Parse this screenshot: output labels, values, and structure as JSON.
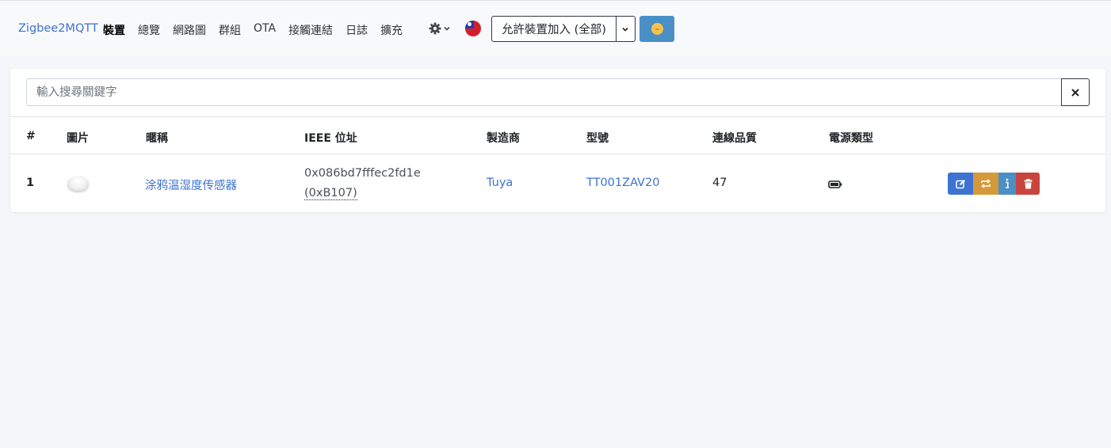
{
  "navbar": {
    "brand": "Zigbee2MQTT",
    "links": [
      {
        "label": "裝置",
        "active": true
      },
      {
        "label": "總覽",
        "active": false
      },
      {
        "label": "網路圖",
        "active": false
      },
      {
        "label": "群組",
        "active": false
      },
      {
        "label": "OTA",
        "active": false
      },
      {
        "label": "接觸連結",
        "active": false
      },
      {
        "label": "日誌",
        "active": false
      },
      {
        "label": "擴充",
        "active": false
      }
    ],
    "settings_icon": "gear-icon",
    "language_flag_icon": "taiwan-flag-icon",
    "permit_join_label": "允許裝置加入 (全部)",
    "theme_icon": "moon-face-icon"
  },
  "search": {
    "placeholder": "輸入搜尋關鍵字",
    "value": "",
    "clear_icon": "close-icon"
  },
  "table": {
    "columns": [
      "#",
      "圖片",
      "暱稱",
      "IEEE 位址",
      "製造商",
      "型號",
      "連線品質",
      "電源類型"
    ],
    "rows": [
      {
        "index": "1",
        "nickname": "涂鸦温湿度传感器",
        "ieee": "0x086bd7fffec2fd1e",
        "nwk": "(0xB107)",
        "manufacturer": "Tuya",
        "model": "TT001ZAV20",
        "lqi": "47",
        "power_icon": "battery-icon",
        "actions": [
          "edit-icon",
          "reconfigure-icon",
          "info-icon",
          "trash-icon"
        ]
      }
    ]
  },
  "colors": {
    "accent": "#3d73d1",
    "edit": "#3d73d1",
    "reconfigure": "#d49a3a",
    "info": "#4a90c7",
    "delete": "#c8453d",
    "page_bg": "#f5f6fa"
  }
}
